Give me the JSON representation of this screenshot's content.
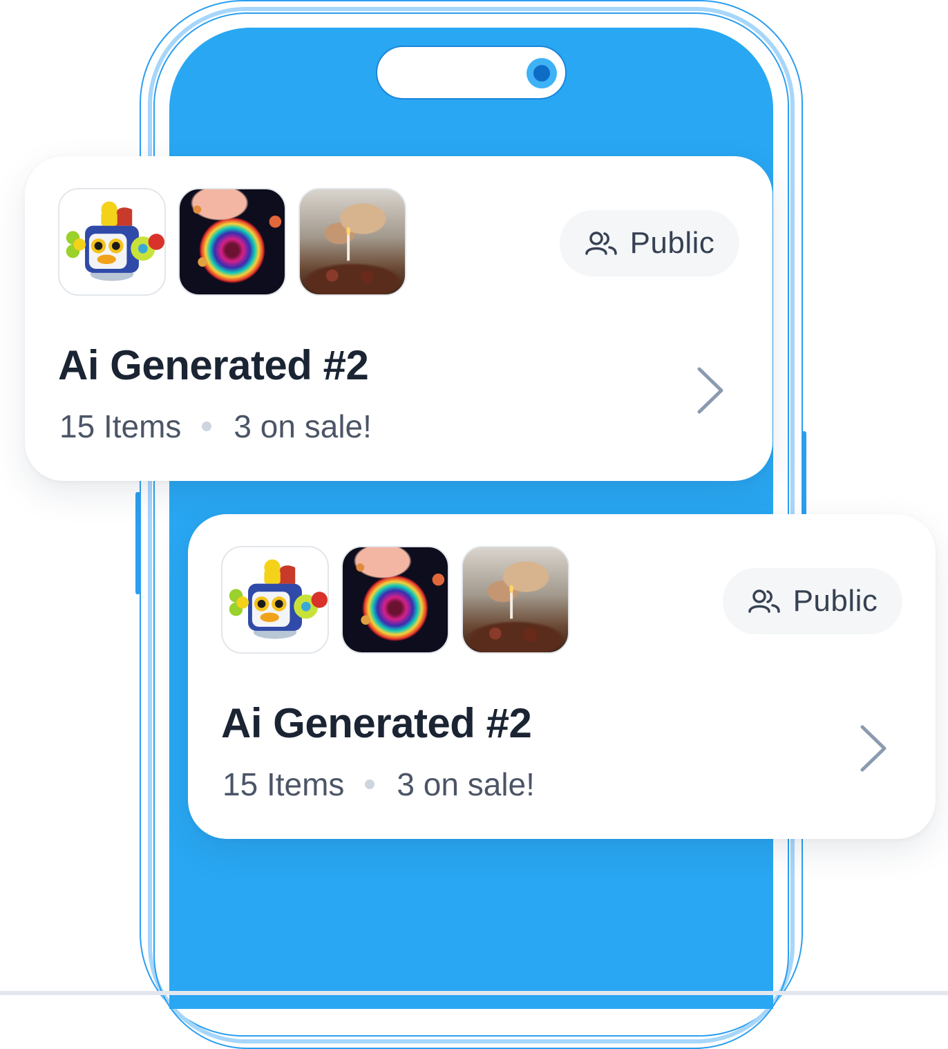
{
  "colors": {
    "screen": "#29a7f2",
    "phone_outline": "#2a9ef0",
    "card_bg": "#ffffff",
    "pill_bg": "#f4f6f8",
    "title": "#1b2433",
    "meta": "#4b5566",
    "chevron": "#8a9bb1"
  },
  "cards": [
    {
      "thumbnails": [
        "robot-toy-image",
        "cosmic-planet-image",
        "family-dinner-image"
      ],
      "visibility": {
        "icon": "users-icon",
        "label": "Public"
      },
      "title": "Ai Generated #2",
      "items": "15 Items",
      "sale": "3 on sale!",
      "action_icon": "chevron-right-icon"
    },
    {
      "thumbnails": [
        "robot-toy-image",
        "cosmic-planet-image",
        "family-dinner-image"
      ],
      "visibility": {
        "icon": "users-icon",
        "label": "Public"
      },
      "title": "Ai Generated #2",
      "items": "15 Items",
      "sale": "3 on sale!",
      "action_icon": "chevron-right-icon"
    }
  ]
}
